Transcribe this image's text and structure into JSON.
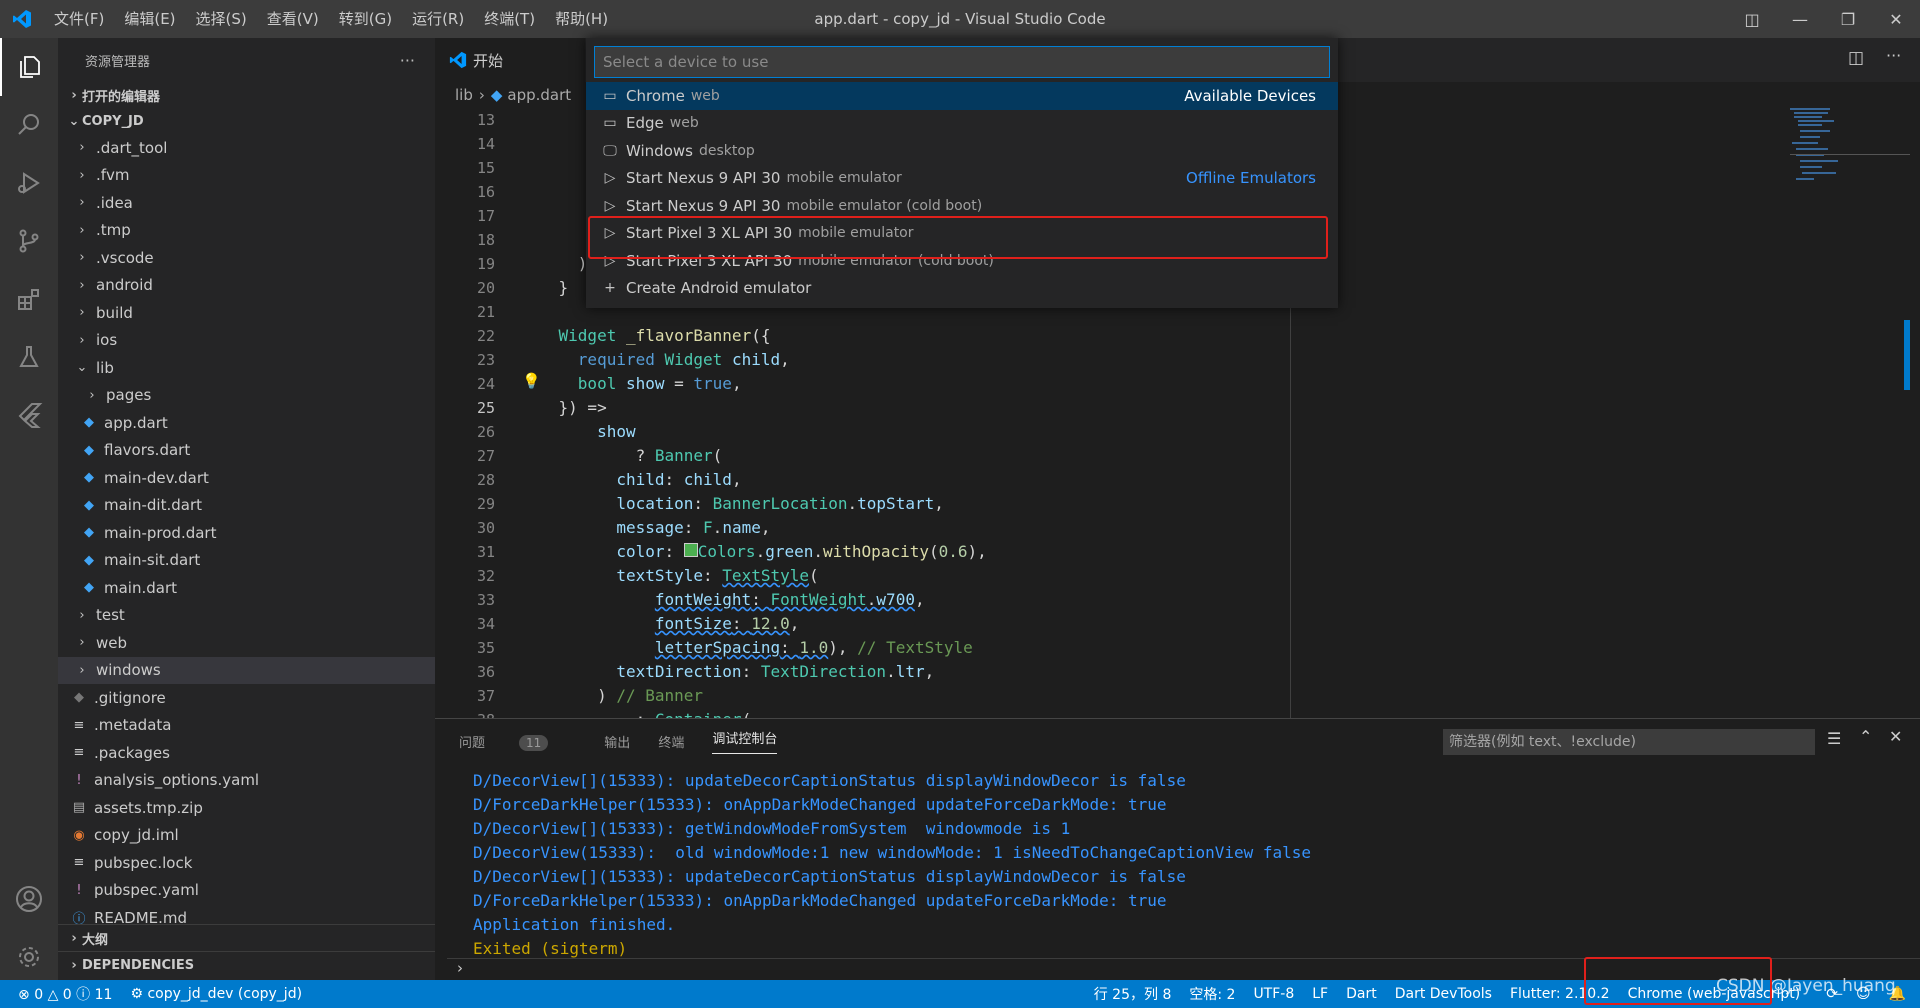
{
  "window": {
    "title": "app.dart - copy_jd - Visual Studio Code"
  },
  "menu": [
    "文件(F)",
    "编辑(E)",
    "选择(S)",
    "查看(V)",
    "转到(G)",
    "运行(R)",
    "终端(T)",
    "帮助(H)"
  ],
  "explorer": {
    "header": "资源管理器",
    "more": "···",
    "open_editors": "打开的编辑器",
    "root": "COPY_JD",
    "outline": "大纲",
    "dependencies": "DEPENDENCIES",
    "items": [
      {
        "label": ".dart_tool",
        "type": "folder"
      },
      {
        "label": ".fvm",
        "type": "folder"
      },
      {
        "label": ".idea",
        "type": "folder"
      },
      {
        "label": ".tmp",
        "type": "folder"
      },
      {
        "label": ".vscode",
        "type": "folder"
      },
      {
        "label": "android",
        "type": "folder"
      },
      {
        "label": "build",
        "type": "folder"
      },
      {
        "label": "ios",
        "type": "folder"
      },
      {
        "label": "lib",
        "type": "folder-open"
      },
      {
        "label": "pages",
        "type": "subfolder"
      },
      {
        "label": "app.dart",
        "type": "dart"
      },
      {
        "label": "flavors.dart",
        "type": "dart"
      },
      {
        "label": "main-dev.dart",
        "type": "dart"
      },
      {
        "label": "main-dit.dart",
        "type": "dart"
      },
      {
        "label": "main-prod.dart",
        "type": "dart"
      },
      {
        "label": "main-sit.dart",
        "type": "dart"
      },
      {
        "label": "main.dart",
        "type": "dart"
      },
      {
        "label": "test",
        "type": "folder"
      },
      {
        "label": "web",
        "type": "folder"
      },
      {
        "label": "windows",
        "type": "folder-selected"
      },
      {
        "label": ".gitignore",
        "type": "git"
      },
      {
        "label": ".metadata",
        "type": "lines"
      },
      {
        "label": ".packages",
        "type": "lines"
      },
      {
        "label": "analysis_options.yaml",
        "type": "yaml"
      },
      {
        "label": "assets.tmp.zip",
        "type": "zip"
      },
      {
        "label": "copy_jd.iml",
        "type": "rss"
      },
      {
        "label": "pubspec.lock",
        "type": "lines"
      },
      {
        "label": "pubspec.yaml",
        "type": "yaml"
      },
      {
        "label": "README.md",
        "type": "info"
      }
    ]
  },
  "editor": {
    "tab_label": "开始",
    "breadcrumb_folder": "lib",
    "breadcrumb_file": "app.dart",
    "line_numbers": [
      "13",
      "14",
      "15",
      "16",
      "17",
      "18",
      "19",
      "20",
      "21",
      "22",
      "23",
      "24",
      "25",
      "26",
      "27",
      "28",
      "29",
      "30",
      "31",
      "32",
      "33",
      "34",
      "35",
      "36",
      "37",
      "38"
    ],
    "current_line": "25"
  },
  "quickpick": {
    "placeholder": "Select a device to use",
    "items": [
      {
        "label": "Chrome",
        "desc": "web",
        "icon": "browser",
        "sep": "Available Devices"
      },
      {
        "label": "Edge",
        "desc": "web",
        "icon": "browser",
        "sep": ""
      },
      {
        "label": "Windows",
        "desc": "desktop",
        "icon": "monitor",
        "sep": ""
      },
      {
        "label": "Start Nexus 9 API 30",
        "desc": "mobile emulator",
        "icon": "play",
        "sep": "Offline Emulators"
      },
      {
        "label": "Start Nexus 9 API 30",
        "desc": "mobile emulator (cold boot)",
        "icon": "play",
        "sep": ""
      },
      {
        "label": "Start Pixel 3 XL API 30",
        "desc": "mobile emulator",
        "icon": "play",
        "sep": ""
      },
      {
        "label": "Start Pixel 3 XL API 30",
        "desc": "mobile emulator (cold boot)",
        "icon": "play",
        "sep": ""
      },
      {
        "label": "Create Android emulator",
        "desc": "",
        "icon": "plus",
        "sep": ""
      }
    ]
  },
  "panel": {
    "tabs": {
      "problems": "问题",
      "problems_count": "11",
      "output": "输出",
      "terminal": "终端",
      "debug_console": "调试控制台"
    },
    "filter_placeholder": "筛选器(例如 text、!exclude)",
    "lines": [
      "D/DecorView[](15333): updateDecorCaptionStatus displayWindowDecor is false",
      "D/ForceDarkHelper(15333): onAppDarkModeChanged updateForceDarkMode: true",
      "D/DecorView[](15333): getWindowModeFromSystem  windowmode is 1",
      "D/DecorView(15333):  old windowMode:1 new windowMode: 1 isNeedToChangeCaptionView false",
      "D/DecorView[](15333): updateDecorCaptionStatus displayWindowDecor is false",
      "D/ForceDarkHelper(15333): onAppDarkModeChanged updateForceDarkMode: true",
      "Application finished."
    ],
    "exit_line": "Exited (sigterm)"
  },
  "statusbar": {
    "errors": "0",
    "warnings": "0",
    "info": "11",
    "flavor": "copy_jd_dev (copy_jd)",
    "position": "行 25，列 8",
    "spaces": "空格: 2",
    "encoding": "UTF-8",
    "eol": "LF",
    "language": "Dart",
    "devtools": "Dart DevTools",
    "flutter": "Flutter: 2.10.2",
    "device": "Chrome (web-javascript)",
    "watermark": "CSDN @Jayen_huang"
  },
  "colors": {
    "accent": "#007acc",
    "highlight_box": "#e0201b",
    "selection": "#04395e"
  }
}
